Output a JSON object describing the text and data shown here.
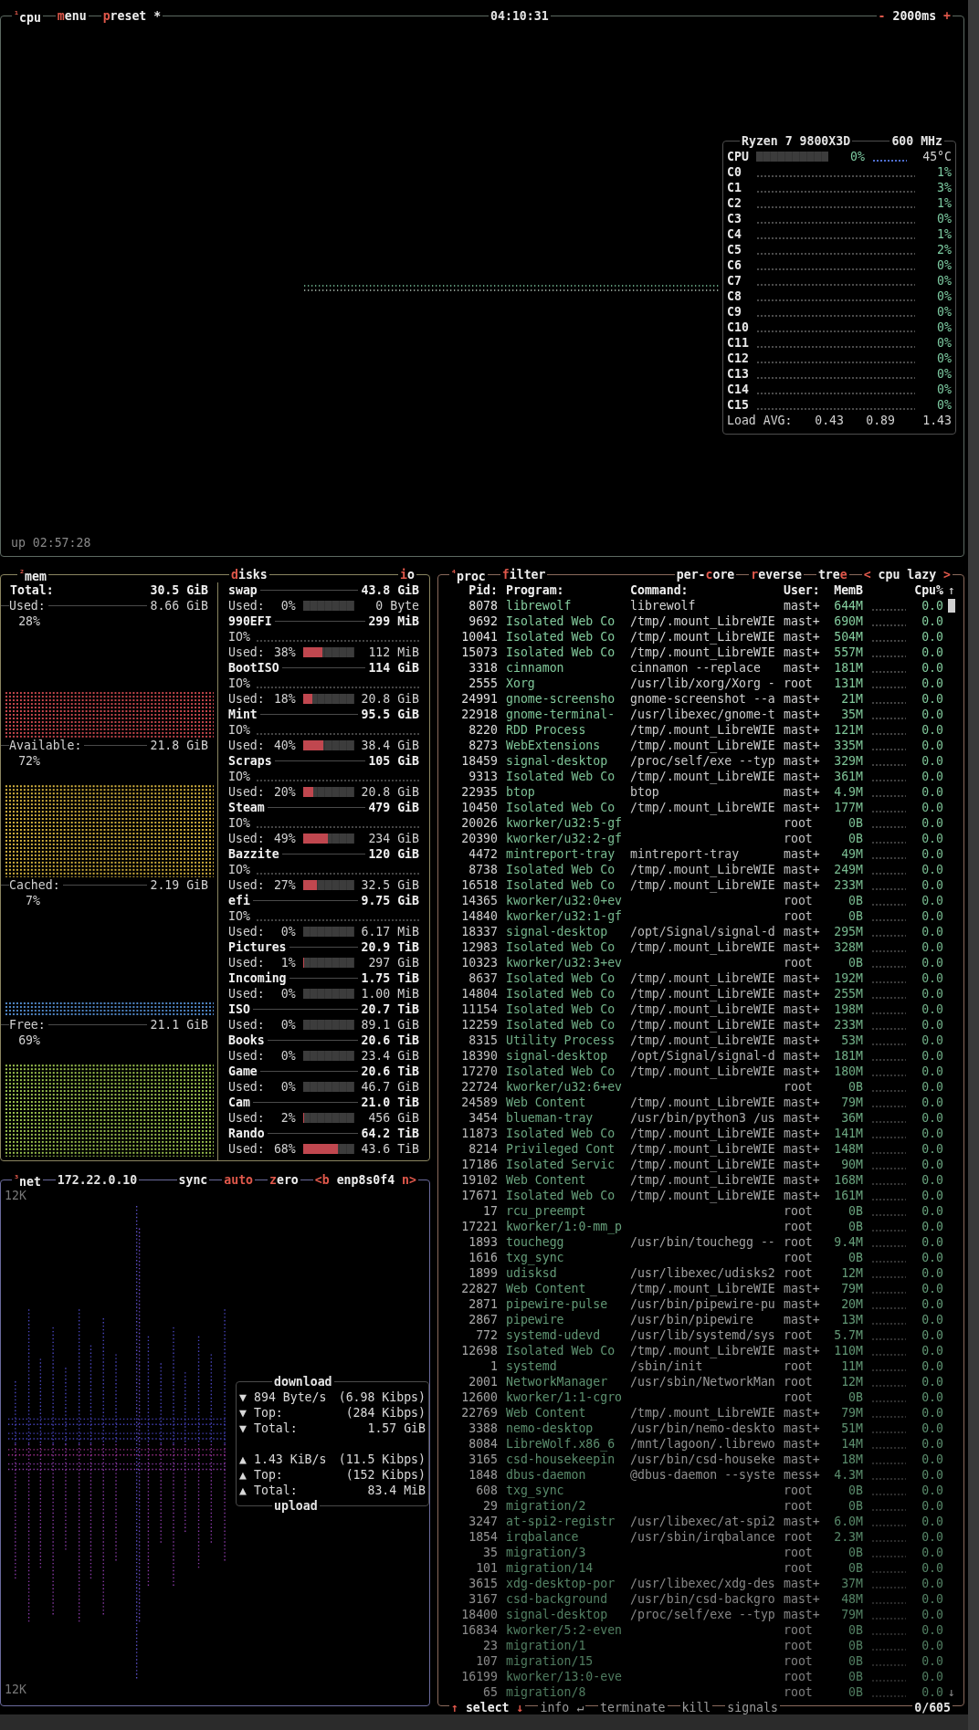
{
  "cpu": {
    "tabs": [
      {
        "number": "¹",
        "parts": [
          {
            "text": "cpu",
            "hot": false
          }
        ]
      },
      {
        "parts": [
          {
            "text": "m",
            "hot": true
          },
          {
            "text": "enu",
            "hot": false
          }
        ]
      },
      {
        "parts": [
          {
            "text": "p",
            "hot": true
          },
          {
            "text": "reset *",
            "hot": false
          }
        ]
      }
    ],
    "clock": "04:10:31",
    "interval": {
      "parts": [
        {
          "text": "-",
          "hot": true
        },
        {
          "text": " 2000ms ",
          "hot": false
        },
        {
          "text": "+",
          "hot": true
        }
      ]
    },
    "panel": {
      "model": "Ryzen 7 9800X3D",
      "freq": "600 MHz",
      "total": {
        "label": "CPU",
        "level": 0.0,
        "percent": "0%",
        "temp": "45°C"
      },
      "cores": [
        {
          "label": "C0",
          "percent": "1%"
        },
        {
          "label": "C1",
          "percent": "3%"
        },
        {
          "label": "C2",
          "percent": "1%"
        },
        {
          "label": "C3",
          "percent": "0%"
        },
        {
          "label": "C4",
          "percent": "1%"
        },
        {
          "label": "C5",
          "percent": "2%"
        },
        {
          "label": "C6",
          "percent": "0%"
        },
        {
          "label": "C7",
          "percent": "0%"
        },
        {
          "label": "C8",
          "percent": "0%"
        },
        {
          "label": "C9",
          "percent": "0%"
        },
        {
          "label": "C10",
          "percent": "0%"
        },
        {
          "label": "C11",
          "percent": "0%"
        },
        {
          "label": "C12",
          "percent": "0%"
        },
        {
          "label": "C13",
          "percent": "0%"
        },
        {
          "label": "C14",
          "percent": "0%"
        },
        {
          "label": "C15",
          "percent": "0%"
        }
      ],
      "load": {
        "label": "Load AVG:",
        "values": [
          "0.43",
          "0.89",
          "1.43"
        ]
      }
    },
    "uptime": "up 02:57:28"
  },
  "mem": {
    "tab": {
      "number": "²",
      "parts": [
        {
          "text": "mem",
          "hot": false
        }
      ]
    },
    "total": {
      "label": "Total:",
      "value": "30.5 GiB"
    },
    "meters": [
      {
        "label": "Used:",
        "value": "8.66 GiB",
        "percent": "28%",
        "color": "#c8474d"
      },
      {
        "label": "Available:",
        "value": "21.8 GiB",
        "percent": "72%",
        "color": "#d4b23e"
      },
      {
        "label": "Cached:",
        "value": "2.19 GiB",
        "percent": "7%",
        "color": "#4f86c6"
      },
      {
        "label": "Free:",
        "value": "21.1 GiB",
        "percent": "69%",
        "color": "#9cc44f"
      }
    ]
  },
  "disks": {
    "tabs": [
      {
        "parts": [
          {
            "text": "d",
            "hot": true
          },
          {
            "text": "isks",
            "hot": false
          }
        ]
      },
      {
        "parts": [
          {
            "text": "i",
            "hot": true
          },
          {
            "text": "o",
            "hot": false
          }
        ]
      }
    ],
    "items": [
      {
        "name": "swap",
        "total": "43.8 GiB",
        "used_label": "Used:",
        "used_pct": "0%",
        "level": 0.0,
        "used": "0 Byte"
      },
      {
        "name": "990EFI",
        "total": "299 MiB",
        "io_label": "IO%",
        "used_label": "Used:",
        "used_pct": "38%",
        "level": 0.38,
        "used": "112 MiB"
      },
      {
        "name": "BootISO",
        "total": "114 GiB",
        "io_label": "IO%",
        "used_label": "Used:",
        "used_pct": "18%",
        "level": 0.18,
        "used": "20.8 GiB"
      },
      {
        "name": "Mint",
        "total": "95.5 GiB",
        "io_label": "IO%",
        "used_label": "Used:",
        "used_pct": "40%",
        "level": 0.4,
        "used": "38.4 GiB"
      },
      {
        "name": "Scraps",
        "total": "105 GiB",
        "io_label": "IO%",
        "used_label": "Used:",
        "used_pct": "20%",
        "level": 0.2,
        "used": "20.8 GiB"
      },
      {
        "name": "Steam",
        "total": "479 GiB",
        "io_label": "IO%",
        "used_label": "Used:",
        "used_pct": "49%",
        "level": 0.49,
        "used": "234 GiB"
      },
      {
        "name": "Bazzite",
        "total": "120 GiB",
        "io_label": "IO%",
        "used_label": "Used:",
        "used_pct": "27%",
        "level": 0.27,
        "used": "32.5 GiB"
      },
      {
        "name": "efi",
        "total": "9.75 GiB",
        "io_label": "IO%",
        "used_label": "Used:",
        "used_pct": "0%",
        "level": 0.0,
        "used": "6.17 MiB"
      },
      {
        "name": "Pictures",
        "total": "20.9 TiB",
        "used_label": "Used:",
        "used_pct": "1%",
        "level": 0.01,
        "used": "297 GiB"
      },
      {
        "name": "Incoming",
        "total": "1.75 TiB",
        "used_label": "Used:",
        "used_pct": "0%",
        "level": 0.0,
        "used": "1.00 MiB"
      },
      {
        "name": "ISO",
        "total": "20.7 TiB",
        "used_label": "Used:",
        "used_pct": "0%",
        "level": 0.0,
        "used": "89.1 GiB"
      },
      {
        "name": "Books",
        "total": "20.6 TiB",
        "used_label": "Used:",
        "used_pct": "0%",
        "level": 0.0,
        "used": "23.4 GiB"
      },
      {
        "name": "Game",
        "total": "20.6 TiB",
        "used_label": "Used:",
        "used_pct": "0%",
        "level": 0.0,
        "used": "46.7 GiB"
      },
      {
        "name": "Cam",
        "total": "21.0 TiB",
        "used_label": "Used:",
        "used_pct": "2%",
        "level": 0.02,
        "used": "456 GiB"
      },
      {
        "name": "Rando",
        "total": "64.2 TiB",
        "used_label": "Used:",
        "used_pct": "68%",
        "level": 0.68,
        "used": "43.6 TiB"
      }
    ]
  },
  "net": {
    "tabs": [
      {
        "number": "³",
        "parts": [
          {
            "text": "net",
            "hot": false
          }
        ]
      }
    ],
    "address": "172.22.0.10",
    "options": [
      {
        "parts": [
          {
            "text": "sync",
            "hot": false
          }
        ]
      },
      {
        "parts": [
          {
            "text": "auto",
            "hot": true
          }
        ]
      },
      {
        "parts": [
          {
            "text": "z",
            "hot": true
          },
          {
            "text": "ero",
            "hot": false
          }
        ]
      },
      {
        "parts": [
          {
            "text": "<b",
            "hot": true
          },
          {
            "text": " enp8s0f4 ",
            "hot": false
          },
          {
            "text": "n>",
            "hot": true
          }
        ]
      }
    ],
    "scale_top": "12K",
    "scale_bottom": "12K",
    "download": {
      "title": "download",
      "rows": [
        {
          "arrow": "▼",
          "label": "894 Byte/s",
          "value": "(6.98 Kibps)"
        },
        {
          "arrow": "▼",
          "label": "Top:",
          "value": "(284 Kibps)"
        },
        {
          "arrow": "▼",
          "label": "Total:",
          "value": "1.57 GiB"
        }
      ]
    },
    "upload": {
      "title": "upload",
      "rows": [
        {
          "arrow": "▲",
          "label": "1.43 KiB/s",
          "value": "(11.5 Kibps)"
        },
        {
          "arrow": "▲",
          "label": "Top:",
          "value": "(152 Kibps)"
        },
        {
          "arrow": "▲",
          "label": "Total:",
          "value": "83.4 MiB"
        }
      ]
    }
  },
  "proc": {
    "tabs_left": [
      {
        "number": "⁴",
        "parts": [
          {
            "text": "proc",
            "hot": false
          }
        ]
      },
      {
        "parts": [
          {
            "text": "f",
            "hot": true
          },
          {
            "text": "ilter",
            "hot": false
          }
        ]
      }
    ],
    "tabs_right": [
      {
        "parts": [
          {
            "text": "per-",
            "hot": false
          },
          {
            "text": "c",
            "hot": true
          },
          {
            "text": "ore",
            "hot": false
          }
        ]
      },
      {
        "parts": [
          {
            "text": "r",
            "hot": true
          },
          {
            "text": "everse",
            "hot": false
          }
        ]
      },
      {
        "parts": [
          {
            "text": "tre",
            "hot": false
          },
          {
            "text": "e",
            "hot": true
          }
        ]
      },
      {
        "parts": [
          {
            "text": "<",
            "hot": true
          },
          {
            "text": " cpu lazy ",
            "hot": false
          },
          {
            "text": ">",
            "hot": true
          }
        ]
      }
    ],
    "columns": [
      "Pid:",
      "Program:",
      "Command:",
      "User:",
      "MemB",
      "Cpu%"
    ],
    "scroll_up": "↑",
    "scroll_down": "↓",
    "rows": [
      {
        "pid": "8078",
        "program": "librewolf",
        "command": "librewolf",
        "user": "mast+",
        "mem": "644M",
        "cpu": "0.0"
      },
      {
        "pid": "9692",
        "program": "Isolated Web Co",
        "command": "/tmp/.mount_LibreWIE",
        "user": "mast+",
        "mem": "690M",
        "cpu": "0.0"
      },
      {
        "pid": "10041",
        "program": "Isolated Web Co",
        "command": "/tmp/.mount_LibreWIE",
        "user": "mast+",
        "mem": "504M",
        "cpu": "0.0"
      },
      {
        "pid": "15073",
        "program": "Isolated Web Co",
        "command": "/tmp/.mount_LibreWIE",
        "user": "mast+",
        "mem": "557M",
        "cpu": "0.0"
      },
      {
        "pid": "3318",
        "program": "cinnamon",
        "command": "cinnamon --replace",
        "user": "mast+",
        "mem": "181M",
        "cpu": "0.0"
      },
      {
        "pid": "2555",
        "program": "Xorg",
        "command": "/usr/lib/xorg/Xorg -",
        "user": "root",
        "mem": "131M",
        "cpu": "0.0"
      },
      {
        "pid": "24991",
        "program": "gnome-screensho",
        "command": "gnome-screenshot --a",
        "user": "mast+",
        "mem": "21M",
        "cpu": "0.0"
      },
      {
        "pid": "22918",
        "program": "gnome-terminal-",
        "command": "/usr/libexec/gnome-t",
        "user": "mast+",
        "mem": "35M",
        "cpu": "0.0"
      },
      {
        "pid": "8220",
        "program": "RDD Process",
        "command": "/tmp/.mount_LibreWIE",
        "user": "mast+",
        "mem": "121M",
        "cpu": "0.0"
      },
      {
        "pid": "8273",
        "program": "WebExtensions",
        "command": "/tmp/.mount_LibreWIE",
        "user": "mast+",
        "mem": "335M",
        "cpu": "0.0"
      },
      {
        "pid": "18459",
        "program": "signal-desktop",
        "command": "/proc/self/exe --typ",
        "user": "mast+",
        "mem": "329M",
        "cpu": "0.0"
      },
      {
        "pid": "9313",
        "program": "Isolated Web Co",
        "command": "/tmp/.mount_LibreWIE",
        "user": "mast+",
        "mem": "361M",
        "cpu": "0.0"
      },
      {
        "pid": "22935",
        "program": "btop",
        "command": "btop",
        "user": "mast+",
        "mem": "4.9M",
        "cpu": "0.0"
      },
      {
        "pid": "10450",
        "program": "Isolated Web Co",
        "command": "/tmp/.mount_LibreWIE",
        "user": "mast+",
        "mem": "177M",
        "cpu": "0.0"
      },
      {
        "pid": "20026",
        "program": "kworker/u32:5-gf",
        "user": "root",
        "mem": "0B",
        "cpu": "0.0"
      },
      {
        "pid": "20390",
        "program": "kworker/u32:2-gf",
        "user": "root",
        "mem": "0B",
        "cpu": "0.0"
      },
      {
        "pid": "4472",
        "program": "mintreport-tray",
        "command": "mintreport-tray",
        "user": "mast+",
        "mem": "49M",
        "cpu": "0.0"
      },
      {
        "pid": "8738",
        "program": "Isolated Web Co",
        "command": "/tmp/.mount_LibreWIE",
        "user": "mast+",
        "mem": "249M",
        "cpu": "0.0"
      },
      {
        "pid": "16518",
        "program": "Isolated Web Co",
        "command": "/tmp/.mount_LibreWIE",
        "user": "mast+",
        "mem": "233M",
        "cpu": "0.0"
      },
      {
        "pid": "14365",
        "program": "kworker/u32:0+ev",
        "user": "root",
        "mem": "0B",
        "cpu": "0.0"
      },
      {
        "pid": "14840",
        "program": "kworker/u32:1-gf",
        "user": "root",
        "mem": "0B",
        "cpu": "0.0"
      },
      {
        "pid": "18337",
        "program": "signal-desktop",
        "command": "/opt/Signal/signal-d",
        "user": "mast+",
        "mem": "295M",
        "cpu": "0.0"
      },
      {
        "pid": "12983",
        "program": "Isolated Web Co",
        "command": "/tmp/.mount_LibreWIE",
        "user": "mast+",
        "mem": "328M",
        "cpu": "0.0"
      },
      {
        "pid": "10323",
        "program": "kworker/u32:3+ev",
        "user": "root",
        "mem": "0B",
        "cpu": "0.0"
      },
      {
        "pid": "8637",
        "program": "Isolated Web Co",
        "command": "/tmp/.mount_LibreWIE",
        "user": "mast+",
        "mem": "192M",
        "cpu": "0.0"
      },
      {
        "pid": "14804",
        "program": "Isolated Web Co",
        "command": "/tmp/.mount_LibreWIE",
        "user": "mast+",
        "mem": "255M",
        "cpu": "0.0"
      },
      {
        "pid": "11154",
        "program": "Isolated Web Co",
        "command": "/tmp/.mount_LibreWIE",
        "user": "mast+",
        "mem": "198M",
        "cpu": "0.0"
      },
      {
        "pid": "12259",
        "program": "Isolated Web Co",
        "command": "/tmp/.mount_LibreWIE",
        "user": "mast+",
        "mem": "233M",
        "cpu": "0.0"
      },
      {
        "pid": "8315",
        "program": "Utility Process",
        "command": "/tmp/.mount_LibreWIE",
        "user": "mast+",
        "mem": "53M",
        "cpu": "0.0"
      },
      {
        "pid": "18390",
        "program": "signal-desktop",
        "command": "/opt/Signal/signal-d",
        "user": "mast+",
        "mem": "181M",
        "cpu": "0.0"
      },
      {
        "pid": "17270",
        "program": "Isolated Web Co",
        "command": "/tmp/.mount_LibreWIE",
        "user": "mast+",
        "mem": "180M",
        "cpu": "0.0"
      },
      {
        "pid": "22724",
        "program": "kworker/u32:6+ev",
        "user": "root",
        "mem": "0B",
        "cpu": "0.0"
      },
      {
        "pid": "24589",
        "program": "Web Content",
        "command": "/tmp/.mount_LibreWIE",
        "user": "mast+",
        "mem": "79M",
        "cpu": "0.0"
      },
      {
        "pid": "3454",
        "program": "blueman-tray",
        "command": "/usr/bin/python3 /us",
        "user": "mast+",
        "mem": "36M",
        "cpu": "0.0"
      },
      {
        "pid": "11873",
        "program": "Isolated Web Co",
        "command": "/tmp/.mount_LibreWIE",
        "user": "mast+",
        "mem": "141M",
        "cpu": "0.0"
      },
      {
        "pid": "8214",
        "program": "Privileged Cont",
        "command": "/tmp/.mount_LibreWIE",
        "user": "mast+",
        "mem": "148M",
        "cpu": "0.0"
      },
      {
        "pid": "17186",
        "program": "Isolated Servic",
        "command": "/tmp/.mount_LibreWIE",
        "user": "mast+",
        "mem": "90M",
        "cpu": "0.0"
      },
      {
        "pid": "19102",
        "program": "Web Content",
        "command": "/tmp/.mount_LibreWIE",
        "user": "mast+",
        "mem": "168M",
        "cpu": "0.0"
      },
      {
        "pid": "17671",
        "program": "Isolated Web Co",
        "command": "/tmp/.mount_LibreWIE",
        "user": "mast+",
        "mem": "161M",
        "cpu": "0.0"
      },
      {
        "pid": "17",
        "program": "rcu_preempt",
        "user": "root",
        "mem": "0B",
        "cpu": "0.0"
      },
      {
        "pid": "17221",
        "program": "kworker/1:0-mm_p",
        "user": "root",
        "mem": "0B",
        "cpu": "0.0"
      },
      {
        "pid": "1893",
        "program": "touchegg",
        "command": "/usr/bin/touchegg --",
        "user": "root",
        "mem": "9.4M",
        "cpu": "0.0"
      },
      {
        "pid": "1616",
        "program": "txg_sync",
        "user": "root",
        "mem": "0B",
        "cpu": "0.0"
      },
      {
        "pid": "1899",
        "program": "udisksd",
        "command": "/usr/libexec/udisks2",
        "user": "root",
        "mem": "12M",
        "cpu": "0.0"
      },
      {
        "pid": "22827",
        "program": "Web Content",
        "command": "/tmp/.mount_LibreWIE",
        "user": "mast+",
        "mem": "79M",
        "cpu": "0.0"
      },
      {
        "pid": "2871",
        "program": "pipewire-pulse",
        "command": "/usr/bin/pipewire-pu",
        "user": "mast+",
        "mem": "20M",
        "cpu": "0.0"
      },
      {
        "pid": "2867",
        "program": "pipewire",
        "command": "/usr/bin/pipewire",
        "user": "mast+",
        "mem": "13M",
        "cpu": "0.0"
      },
      {
        "pid": "772",
        "program": "systemd-udevd",
        "command": "/usr/lib/systemd/sys",
        "user": "root",
        "mem": "5.7M",
        "cpu": "0.0"
      },
      {
        "pid": "12698",
        "program": "Isolated Web Co",
        "command": "/tmp/.mount_LibreWIE",
        "user": "mast+",
        "mem": "110M",
        "cpu": "0.0"
      },
      {
        "pid": "1",
        "program": "systemd",
        "command": "/sbin/init",
        "user": "root",
        "mem": "11M",
        "cpu": "0.0"
      },
      {
        "pid": "2001",
        "program": "NetworkManager",
        "command": "/usr/sbin/NetworkMan",
        "user": "root",
        "mem": "12M",
        "cpu": "0.0"
      },
      {
        "pid": "12600",
        "program": "kworker/1:1-cgro",
        "user": "root",
        "mem": "0B",
        "cpu": "0.0"
      },
      {
        "pid": "22769",
        "program": "Web Content",
        "command": "/tmp/.mount_LibreWIE",
        "user": "mast+",
        "mem": "79M",
        "cpu": "0.0"
      },
      {
        "pid": "3388",
        "program": "nemo-desktop",
        "command": "/usr/bin/nemo-deskto",
        "user": "mast+",
        "mem": "51M",
        "cpu": "0.0"
      },
      {
        "pid": "8084",
        "program": "LibreWolf.x86_6",
        "command": "/mnt/lagoon/.librewo",
        "user": "mast+",
        "mem": "14M",
        "cpu": "0.0"
      },
      {
        "pid": "3165",
        "program": "csd-housekeepin",
        "command": "/usr/bin/csd-houseke",
        "user": "mast+",
        "mem": "18M",
        "cpu": "0.0"
      },
      {
        "pid": "1848",
        "program": "dbus-daemon",
        "command": "@dbus-daemon --syste",
        "user": "mess+",
        "mem": "4.3M",
        "cpu": "0.0"
      },
      {
        "pid": "608",
        "program": "txg_sync",
        "user": "root",
        "mem": "0B",
        "cpu": "0.0"
      },
      {
        "pid": "29",
        "program": "migration/2",
        "user": "root",
        "mem": "0B",
        "cpu": "0.0"
      },
      {
        "pid": "3247",
        "program": "at-spi2-registr",
        "command": "/usr/libexec/at-spi2",
        "user": "mast+",
        "mem": "6.0M",
        "cpu": "0.0"
      },
      {
        "pid": "1854",
        "program": "irqbalance",
        "command": "/usr/sbin/irqbalance",
        "user": "root",
        "mem": "2.3M",
        "cpu": "0.0"
      },
      {
        "pid": "35",
        "program": "migration/3",
        "user": "root",
        "mem": "0B",
        "cpu": "0.0"
      },
      {
        "pid": "101",
        "program": "migration/14",
        "user": "root",
        "mem": "0B",
        "cpu": "0.0"
      },
      {
        "pid": "3615",
        "program": "xdg-desktop-por",
        "command": "/usr/libexec/xdg-des",
        "user": "mast+",
        "mem": "37M",
        "cpu": "0.0"
      },
      {
        "pid": "3167",
        "program": "csd-background",
        "command": "/usr/bin/csd-backgro",
        "user": "mast+",
        "mem": "48M",
        "cpu": "0.0"
      },
      {
        "pid": "18400",
        "program": "signal-desktop",
        "command": "/proc/self/exe --typ",
        "user": "mast+",
        "mem": "79M",
        "cpu": "0.0"
      },
      {
        "pid": "16834",
        "program": "kworker/5:2-even",
        "user": "root",
        "mem": "0B",
        "cpu": "0.0"
      },
      {
        "pid": "23",
        "program": "migration/1",
        "user": "root",
        "mem": "0B",
        "cpu": "0.0"
      },
      {
        "pid": "107",
        "program": "migration/15",
        "user": "root",
        "mem": "0B",
        "cpu": "0.0"
      },
      {
        "pid": "16199",
        "program": "kworker/13:0-eve",
        "user": "root",
        "mem": "0B",
        "cpu": "0.0"
      },
      {
        "pid": "65",
        "program": "migration/8",
        "user": "root",
        "mem": "0B",
        "cpu": "0.0"
      }
    ],
    "footer": [
      {
        "dim": false,
        "parts": [
          {
            "text": "↑",
            "hot": true
          },
          {
            "text": " select ",
            "hot": false
          },
          {
            "text": "↓",
            "hot": true
          }
        ]
      },
      {
        "dim": true,
        "parts": [
          {
            "text": "info ↵",
            "hot": false
          }
        ]
      },
      {
        "dim": true,
        "parts": [
          {
            "text": "terminate",
            "hot": false
          }
        ]
      },
      {
        "dim": true,
        "parts": [
          {
            "text": "kill",
            "hot": false
          }
        ]
      },
      {
        "dim": true,
        "parts": [
          {
            "text": "signals",
            "hot": false
          }
        ]
      }
    ],
    "count": "0/605"
  }
}
